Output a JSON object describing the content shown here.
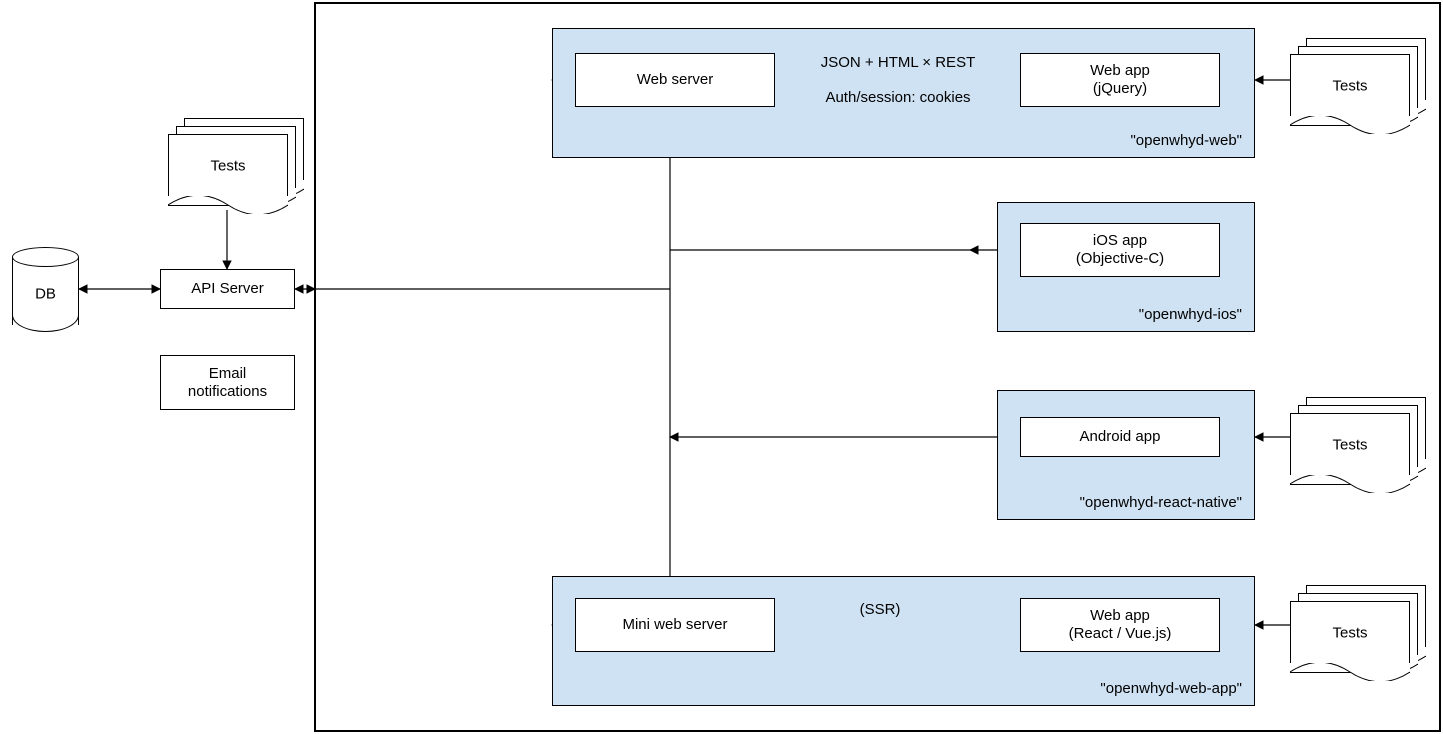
{
  "db": {
    "label": "DB"
  },
  "left": {
    "tests": "Tests",
    "api_server": "API Server",
    "email": "Email\nnotifications"
  },
  "panels": {
    "web": {
      "label": "\"openwhyd-web\"",
      "web_server": "Web server",
      "web_app": "Web app\n(jQuery)",
      "conn1": "JSON + HTML × REST",
      "conn2": "Auth/session: cookies"
    },
    "ios": {
      "label": "\"openwhyd-ios\"",
      "app": "iOS app\n(Objective-C)"
    },
    "android": {
      "label": "\"openwhyd-react-native\"",
      "app": "Android app"
    },
    "webapp": {
      "label": "\"openwhyd-web-app\"",
      "server": "Mini web server",
      "app": "Web app\n(React / Vue.js)",
      "conn": "(SSR)"
    }
  },
  "tests_right": {
    "t1": "Tests",
    "t2": "Tests",
    "t3": "Tests"
  }
}
